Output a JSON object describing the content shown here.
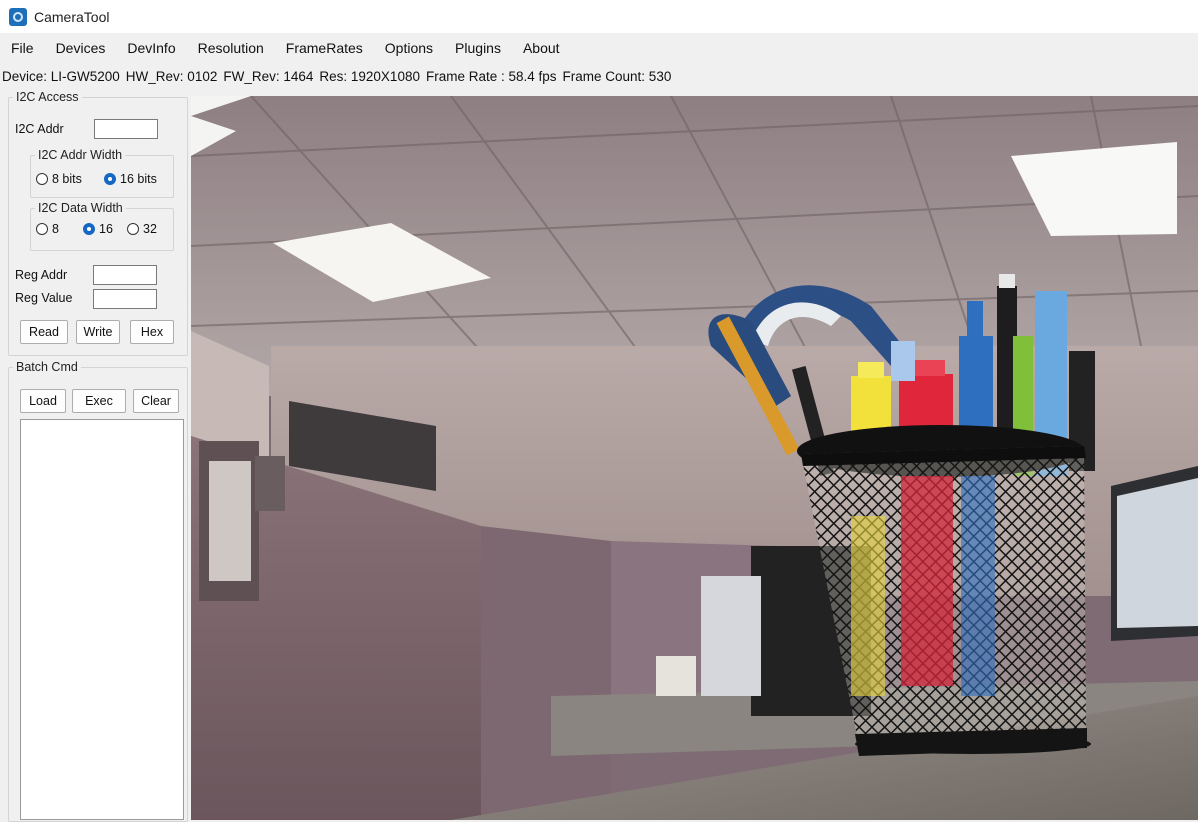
{
  "window": {
    "title": "CameraTool"
  },
  "menu": [
    "File",
    "Devices",
    "DevInfo",
    "Resolution",
    "FrameRates",
    "Options",
    "Plugins",
    "About"
  ],
  "status": {
    "device": "Device:  LI-GW5200",
    "hw_rev": "HW_Rev:  0102",
    "fw_rev": "FW_Rev:  1464",
    "res": "Res:  1920X1080",
    "frame_rate": "Frame Rate :  58.4 fps",
    "frame_count": "Frame Count: 530"
  },
  "i2c": {
    "group_label": "I2C Access",
    "addr_label": "I2C Addr",
    "addr_value": "",
    "addr_width_label": "I2C Addr Width",
    "addr_width_options": [
      "8 bits",
      "16 bits"
    ],
    "addr_width_selected": "16 bits",
    "data_width_label": "I2C Data Width",
    "data_width_options": [
      "8",
      "16",
      "32"
    ],
    "data_width_selected": "16",
    "reg_addr_label": "Reg Addr",
    "reg_addr_value": "",
    "reg_value_label": "Reg Value",
    "reg_value_value": "",
    "read_label": "Read",
    "write_label": "Write",
    "hex_label": "Hex"
  },
  "batch": {
    "group_label": "Batch Cmd",
    "load_label": "Load",
    "exec_label": "Exec",
    "clear_label": "Clear"
  },
  "colors": {
    "accent": "#1666c4",
    "app_icon": "#1d6fb8"
  }
}
